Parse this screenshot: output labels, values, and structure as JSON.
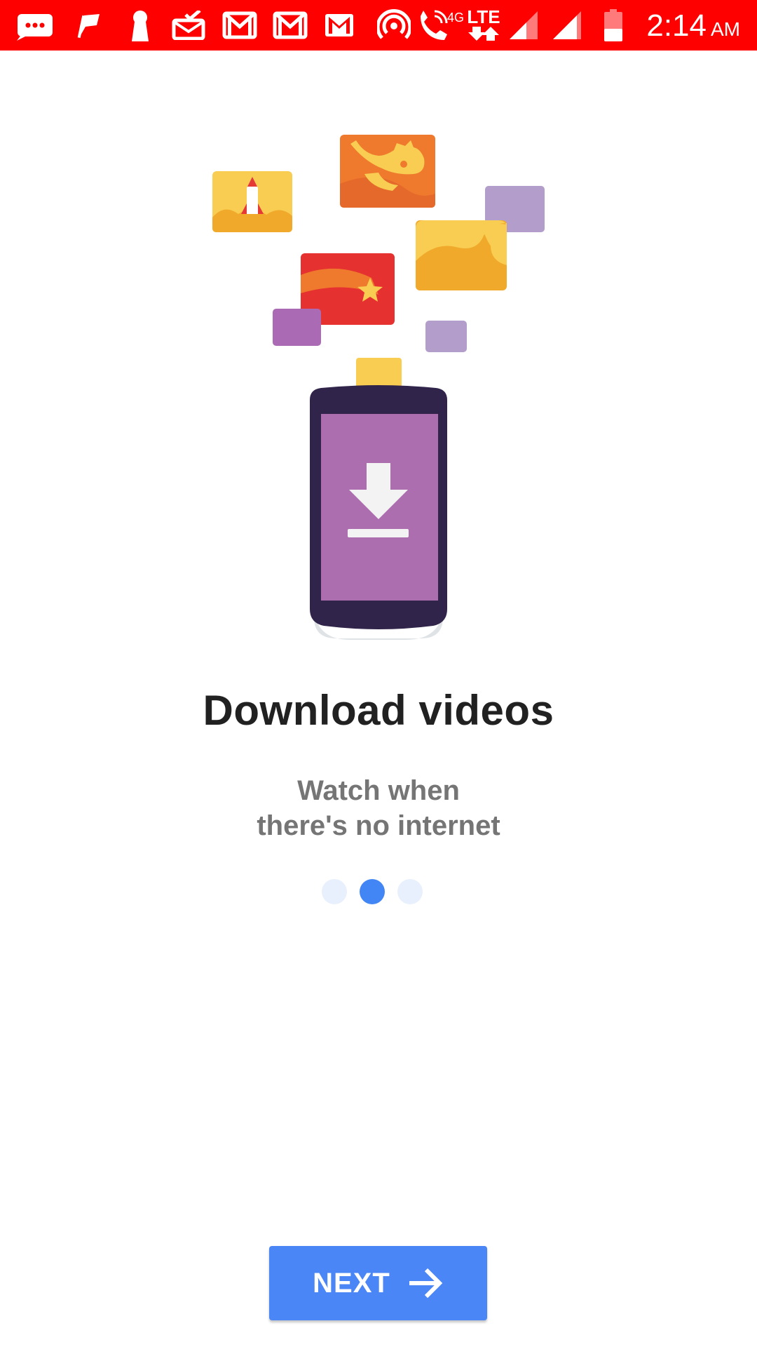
{
  "status_bar": {
    "icons": [
      "messages-icon",
      "flag-icon",
      "keyhole-icon",
      "mail-check-icon",
      "gmail-icon",
      "gmail-icon",
      "gmail-icon",
      "hotspot-icon",
      "wifi-calling-icon",
      "lte-data-icon",
      "signal-icon",
      "signal-icon",
      "battery-icon"
    ],
    "network_label": "4G",
    "data_label": "LTE",
    "time": "2:14",
    "ampm": "AM",
    "color": "#ff0000"
  },
  "onboarding": {
    "title": "Download videos",
    "subtitle_line1": "Watch when",
    "subtitle_line2": "there's no internet",
    "pages_total": 3,
    "current_page": 2
  },
  "next_button": {
    "label": "NEXT",
    "color": "#4a86f6"
  }
}
